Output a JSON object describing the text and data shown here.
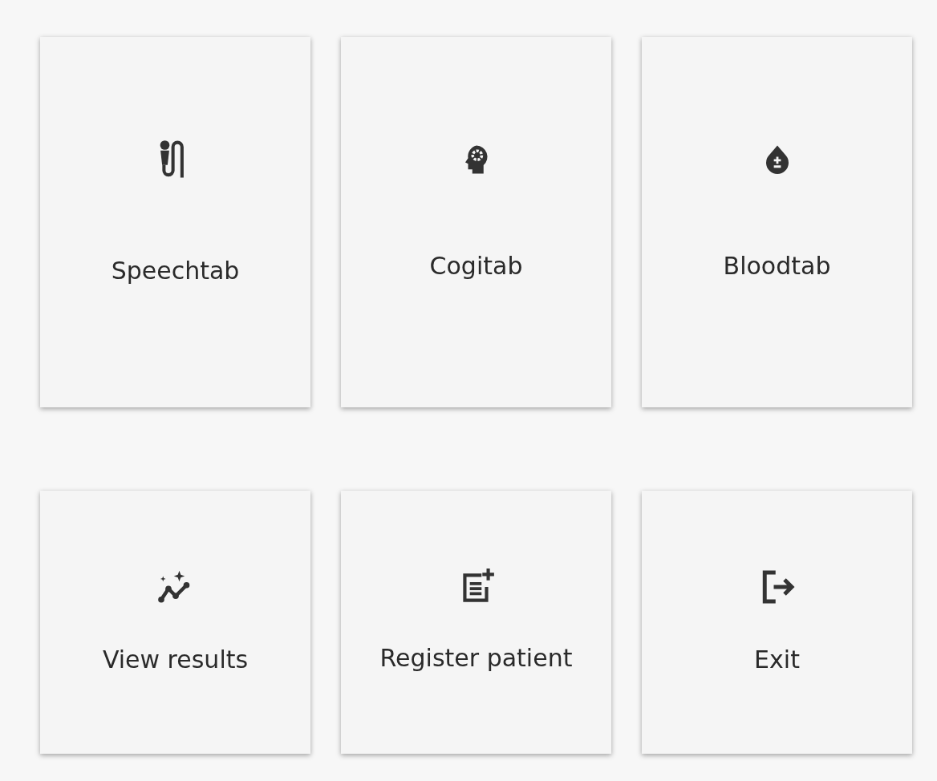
{
  "tiles": [
    {
      "label": "Speechtab"
    },
    {
      "label": "Cogitab"
    },
    {
      "label": "Bloodtab"
    },
    {
      "label": "View results"
    },
    {
      "label": "Register patient"
    },
    {
      "label": "Exit"
    }
  ]
}
